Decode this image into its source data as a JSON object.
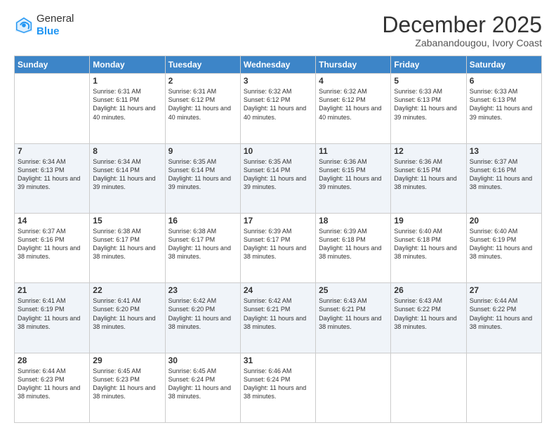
{
  "header": {
    "logo": {
      "general": "General",
      "blue": "Blue"
    },
    "title": "December 2025",
    "subtitle": "Zabanandougou, Ivory Coast"
  },
  "calendar": {
    "days_of_week": [
      "Sunday",
      "Monday",
      "Tuesday",
      "Wednesday",
      "Thursday",
      "Friday",
      "Saturday"
    ],
    "weeks": [
      [
        {
          "day": "",
          "sunrise": "",
          "sunset": "",
          "daylight": ""
        },
        {
          "day": "1",
          "sunrise": "Sunrise: 6:31 AM",
          "sunset": "Sunset: 6:11 PM",
          "daylight": "Daylight: 11 hours and 40 minutes."
        },
        {
          "day": "2",
          "sunrise": "Sunrise: 6:31 AM",
          "sunset": "Sunset: 6:12 PM",
          "daylight": "Daylight: 11 hours and 40 minutes."
        },
        {
          "day": "3",
          "sunrise": "Sunrise: 6:32 AM",
          "sunset": "Sunset: 6:12 PM",
          "daylight": "Daylight: 11 hours and 40 minutes."
        },
        {
          "day": "4",
          "sunrise": "Sunrise: 6:32 AM",
          "sunset": "Sunset: 6:12 PM",
          "daylight": "Daylight: 11 hours and 40 minutes."
        },
        {
          "day": "5",
          "sunrise": "Sunrise: 6:33 AM",
          "sunset": "Sunset: 6:13 PM",
          "daylight": "Daylight: 11 hours and 39 minutes."
        },
        {
          "day": "6",
          "sunrise": "Sunrise: 6:33 AM",
          "sunset": "Sunset: 6:13 PM",
          "daylight": "Daylight: 11 hours and 39 minutes."
        }
      ],
      [
        {
          "day": "7",
          "sunrise": "Sunrise: 6:34 AM",
          "sunset": "Sunset: 6:13 PM",
          "daylight": "Daylight: 11 hours and 39 minutes."
        },
        {
          "day": "8",
          "sunrise": "Sunrise: 6:34 AM",
          "sunset": "Sunset: 6:14 PM",
          "daylight": "Daylight: 11 hours and 39 minutes."
        },
        {
          "day": "9",
          "sunrise": "Sunrise: 6:35 AM",
          "sunset": "Sunset: 6:14 PM",
          "daylight": "Daylight: 11 hours and 39 minutes."
        },
        {
          "day": "10",
          "sunrise": "Sunrise: 6:35 AM",
          "sunset": "Sunset: 6:14 PM",
          "daylight": "Daylight: 11 hours and 39 minutes."
        },
        {
          "day": "11",
          "sunrise": "Sunrise: 6:36 AM",
          "sunset": "Sunset: 6:15 PM",
          "daylight": "Daylight: 11 hours and 39 minutes."
        },
        {
          "day": "12",
          "sunrise": "Sunrise: 6:36 AM",
          "sunset": "Sunset: 6:15 PM",
          "daylight": "Daylight: 11 hours and 38 minutes."
        },
        {
          "day": "13",
          "sunrise": "Sunrise: 6:37 AM",
          "sunset": "Sunset: 6:16 PM",
          "daylight": "Daylight: 11 hours and 38 minutes."
        }
      ],
      [
        {
          "day": "14",
          "sunrise": "Sunrise: 6:37 AM",
          "sunset": "Sunset: 6:16 PM",
          "daylight": "Daylight: 11 hours and 38 minutes."
        },
        {
          "day": "15",
          "sunrise": "Sunrise: 6:38 AM",
          "sunset": "Sunset: 6:17 PM",
          "daylight": "Daylight: 11 hours and 38 minutes."
        },
        {
          "day": "16",
          "sunrise": "Sunrise: 6:38 AM",
          "sunset": "Sunset: 6:17 PM",
          "daylight": "Daylight: 11 hours and 38 minutes."
        },
        {
          "day": "17",
          "sunrise": "Sunrise: 6:39 AM",
          "sunset": "Sunset: 6:17 PM",
          "daylight": "Daylight: 11 hours and 38 minutes."
        },
        {
          "day": "18",
          "sunrise": "Sunrise: 6:39 AM",
          "sunset": "Sunset: 6:18 PM",
          "daylight": "Daylight: 11 hours and 38 minutes."
        },
        {
          "day": "19",
          "sunrise": "Sunrise: 6:40 AM",
          "sunset": "Sunset: 6:18 PM",
          "daylight": "Daylight: 11 hours and 38 minutes."
        },
        {
          "day": "20",
          "sunrise": "Sunrise: 6:40 AM",
          "sunset": "Sunset: 6:19 PM",
          "daylight": "Daylight: 11 hours and 38 minutes."
        }
      ],
      [
        {
          "day": "21",
          "sunrise": "Sunrise: 6:41 AM",
          "sunset": "Sunset: 6:19 PM",
          "daylight": "Daylight: 11 hours and 38 minutes."
        },
        {
          "day": "22",
          "sunrise": "Sunrise: 6:41 AM",
          "sunset": "Sunset: 6:20 PM",
          "daylight": "Daylight: 11 hours and 38 minutes."
        },
        {
          "day": "23",
          "sunrise": "Sunrise: 6:42 AM",
          "sunset": "Sunset: 6:20 PM",
          "daylight": "Daylight: 11 hours and 38 minutes."
        },
        {
          "day": "24",
          "sunrise": "Sunrise: 6:42 AM",
          "sunset": "Sunset: 6:21 PM",
          "daylight": "Daylight: 11 hours and 38 minutes."
        },
        {
          "day": "25",
          "sunrise": "Sunrise: 6:43 AM",
          "sunset": "Sunset: 6:21 PM",
          "daylight": "Daylight: 11 hours and 38 minutes."
        },
        {
          "day": "26",
          "sunrise": "Sunrise: 6:43 AM",
          "sunset": "Sunset: 6:22 PM",
          "daylight": "Daylight: 11 hours and 38 minutes."
        },
        {
          "day": "27",
          "sunrise": "Sunrise: 6:44 AM",
          "sunset": "Sunset: 6:22 PM",
          "daylight": "Daylight: 11 hours and 38 minutes."
        }
      ],
      [
        {
          "day": "28",
          "sunrise": "Sunrise: 6:44 AM",
          "sunset": "Sunset: 6:23 PM",
          "daylight": "Daylight: 11 hours and 38 minutes."
        },
        {
          "day": "29",
          "sunrise": "Sunrise: 6:45 AM",
          "sunset": "Sunset: 6:23 PM",
          "daylight": "Daylight: 11 hours and 38 minutes."
        },
        {
          "day": "30",
          "sunrise": "Sunrise: 6:45 AM",
          "sunset": "Sunset: 6:24 PM",
          "daylight": "Daylight: 11 hours and 38 minutes."
        },
        {
          "day": "31",
          "sunrise": "Sunrise: 6:46 AM",
          "sunset": "Sunset: 6:24 PM",
          "daylight": "Daylight: 11 hours and 38 minutes."
        },
        {
          "day": "",
          "sunrise": "",
          "sunset": "",
          "daylight": ""
        },
        {
          "day": "",
          "sunrise": "",
          "sunset": "",
          "daylight": ""
        },
        {
          "day": "",
          "sunrise": "",
          "sunset": "",
          "daylight": ""
        }
      ]
    ]
  }
}
